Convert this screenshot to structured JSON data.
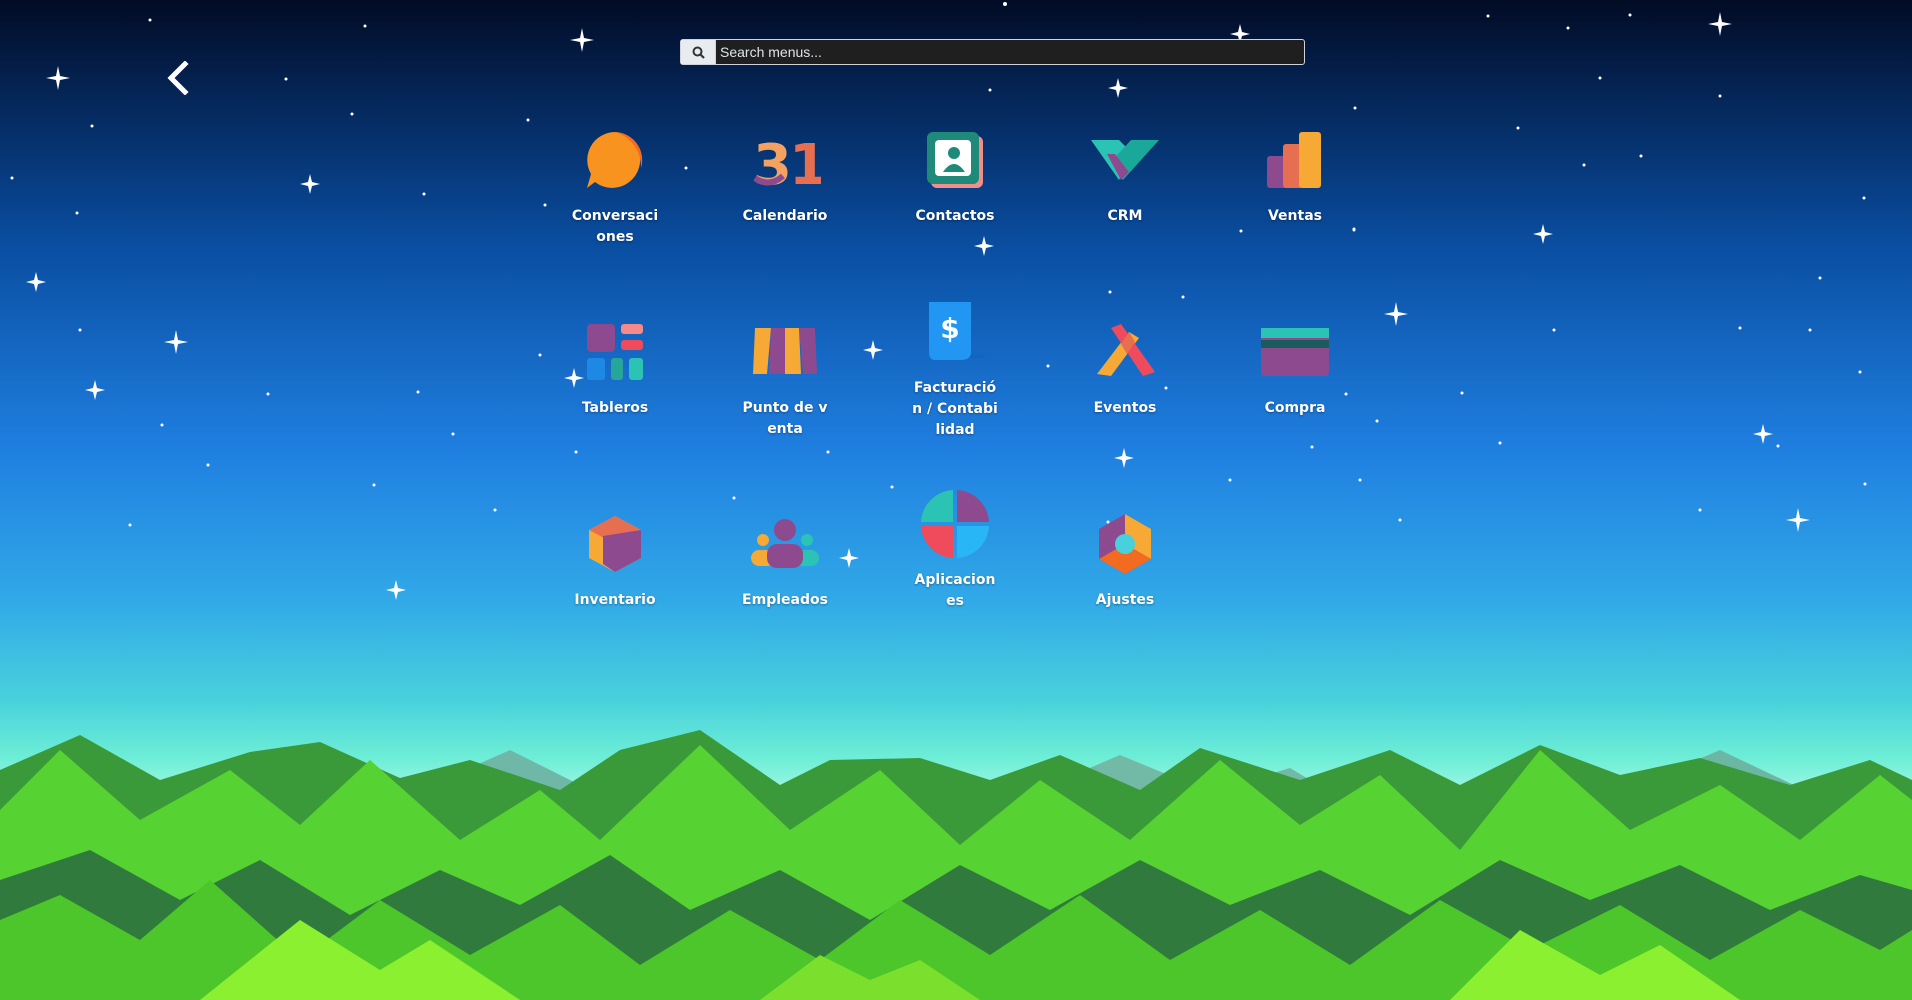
{
  "search": {
    "placeholder": "Search menus..."
  },
  "nav": {
    "back_icon": "chevron-left-icon"
  },
  "apps": [
    {
      "label": "Conversaciones",
      "icon": "chat-bubble-icon"
    },
    {
      "label": "Calendario",
      "icon": "calendar-31-icon"
    },
    {
      "label": "Contactos",
      "icon": "contact-card-icon"
    },
    {
      "label": "CRM",
      "icon": "handshake-icon"
    },
    {
      "label": "Ventas",
      "icon": "bar-chart-icon"
    },
    {
      "label": "Tableros",
      "icon": "dashboard-tiles-icon"
    },
    {
      "label": "Punto de venta",
      "icon": "shop-awning-icon"
    },
    {
      "label": "Facturación / Contabilidad",
      "icon": "invoice-dollar-icon"
    },
    {
      "label": "Eventos",
      "icon": "crossed-ribbons-icon"
    },
    {
      "label": "Compra",
      "icon": "credit-card-icon"
    },
    {
      "label": "Inventario",
      "icon": "cube-icon"
    },
    {
      "label": "Empleados",
      "icon": "people-group-icon"
    },
    {
      "label": "Aplicaciones",
      "icon": "quad-circle-icon"
    },
    {
      "label": "Ajustes",
      "icon": "hexagon-gear-icon"
    }
  ],
  "colors": {
    "sky_top": "#020b24",
    "sky_mid": "#1f7fe0",
    "sky_horizon": "#6fefd6",
    "mountain_light": "#4ccc2a",
    "mountain_dark": "#2f7a3c"
  }
}
